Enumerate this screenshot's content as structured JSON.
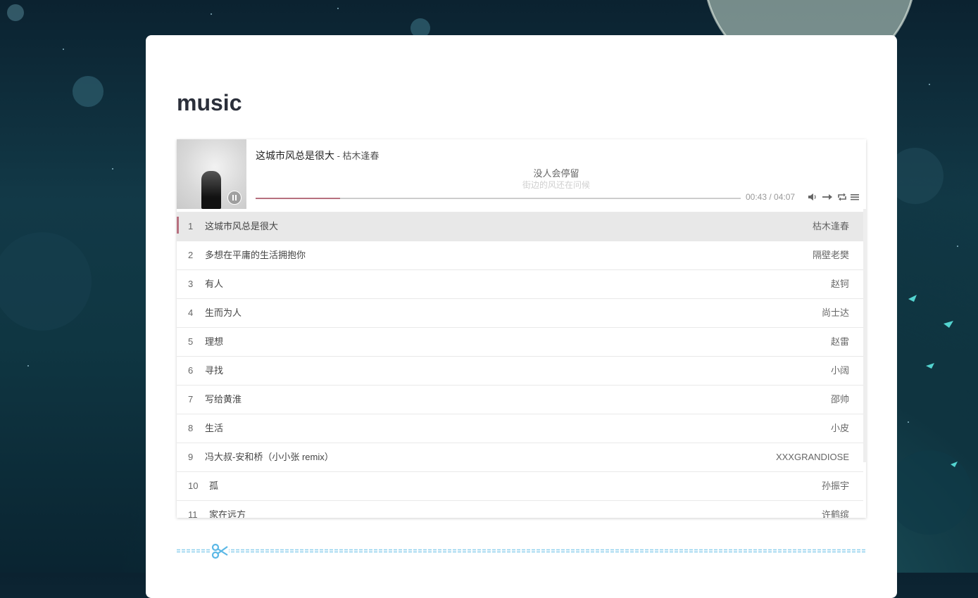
{
  "page": {
    "title": "music"
  },
  "player": {
    "current": {
      "title": "这城市风总是很大",
      "artist": " - 枯木逢春"
    },
    "lyrics": {
      "current": "没人会停留",
      "next": "街边的风还在问候"
    },
    "progress": 0.174,
    "time": "00:43 / 04:07",
    "icons": [
      "pause-icon",
      "volume-icon",
      "order-icon",
      "loop-icon",
      "menu-icon"
    ],
    "accent": "#b7707f"
  },
  "playlist": [
    {
      "index": "1",
      "title": "这城市风总是很大",
      "artist": "枯木逢春"
    },
    {
      "index": "2",
      "title": "多想在平庸的生活拥抱你",
      "artist": "隔壁老樊"
    },
    {
      "index": "3",
      "title": "有人",
      "artist": "赵钶"
    },
    {
      "index": "4",
      "title": "生而为人",
      "artist": "尚士达"
    },
    {
      "index": "5",
      "title": "理想",
      "artist": "赵雷"
    },
    {
      "index": "6",
      "title": "寻找",
      "artist": "小阔"
    },
    {
      "index": "7",
      "title": "写给黄淮",
      "artist": "邵帅"
    },
    {
      "index": "8",
      "title": "生活",
      "artist": "小皮"
    },
    {
      "index": "9",
      "title": "冯大叔-安和桥（小小张 remix）",
      "artist": "XXXGRANDIOSE"
    },
    {
      "index": "10",
      "title": "孤",
      "artist": "孙振宇"
    },
    {
      "index": "11",
      "title": "家在远方",
      "artist": "许鹤缤"
    }
  ]
}
